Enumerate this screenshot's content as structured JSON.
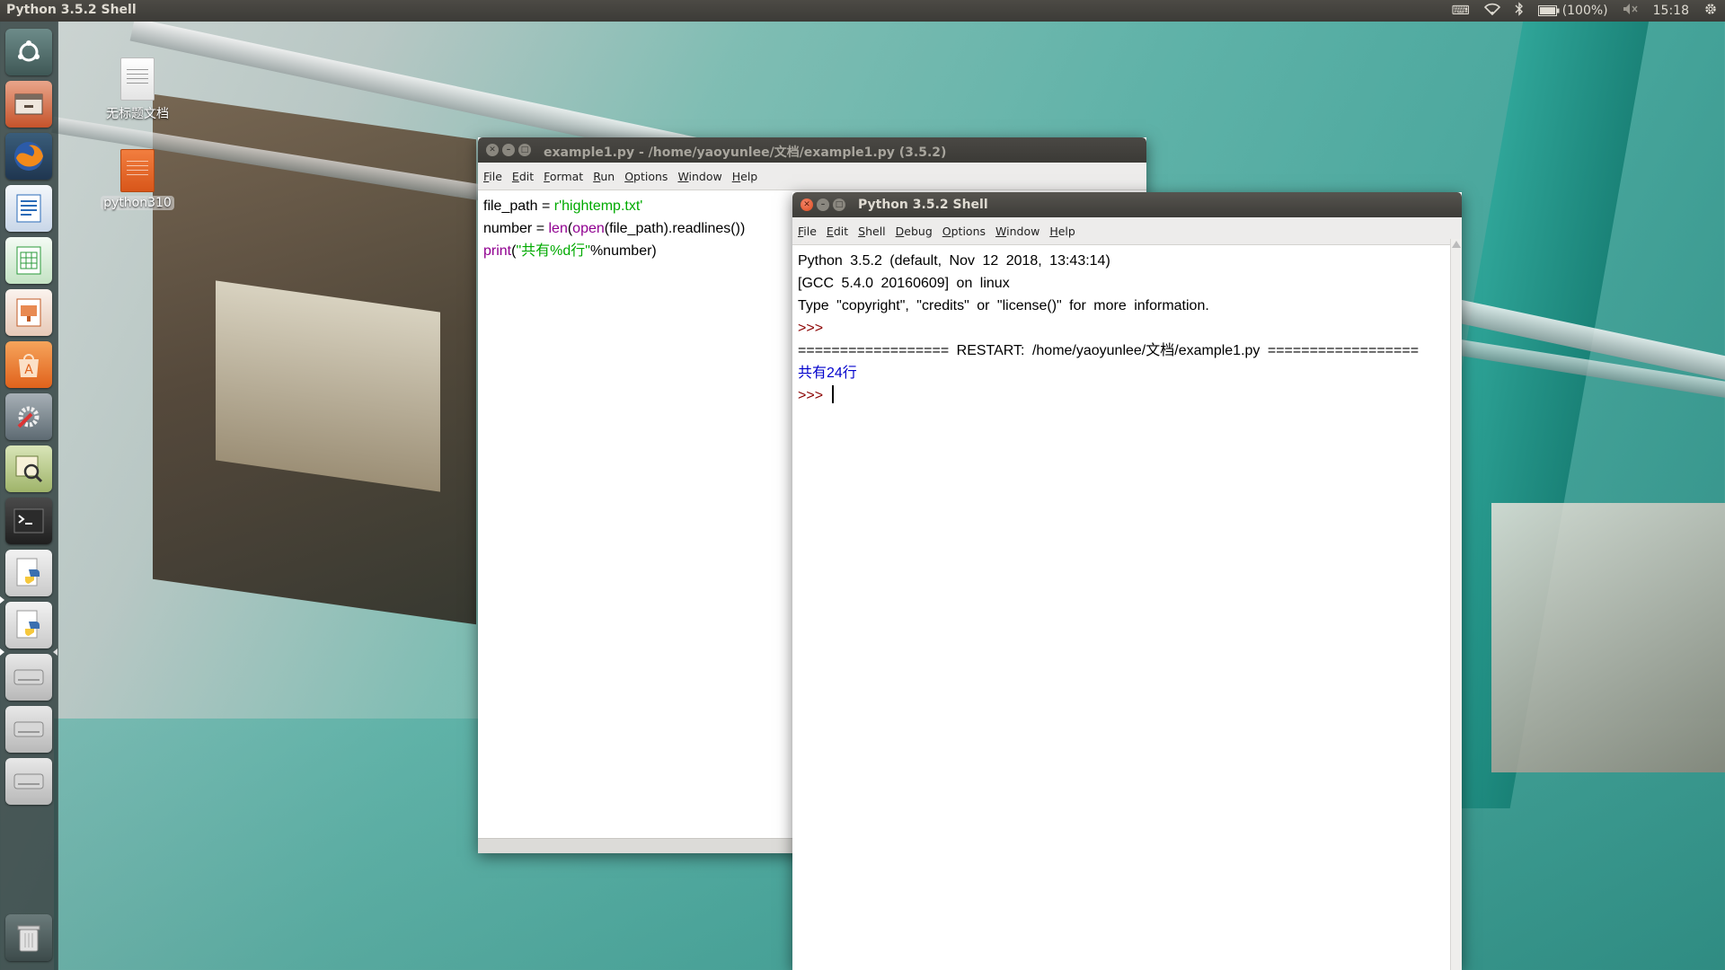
{
  "topbar": {
    "app_title": "Python 3.5.2 Shell",
    "battery": "(100%)",
    "time": "15:18"
  },
  "desktop": {
    "icons": [
      {
        "label": "无标题文档",
        "icon": "document-icon"
      },
      {
        "label": "python310",
        "icon": "python-file-icon"
      }
    ]
  },
  "launcher": {
    "items": [
      "dash-icon",
      "files-icon",
      "firefox-icon",
      "writer-icon",
      "calc-icon",
      "impress-icon",
      "software-center-icon",
      "system-settings-icon",
      "image-viewer-icon",
      "terminal-icon",
      "idle-icon",
      "idle-icon-2",
      "drive-icon",
      "drive-icon-2",
      "drive-icon-3",
      "trash-icon"
    ]
  },
  "editor": {
    "title": "example1.py - /home/yaoyunlee/文档/example1.py (3.5.2)",
    "menu": [
      "File",
      "Edit",
      "Format",
      "Run",
      "Options",
      "Window",
      "Help"
    ],
    "lines": {
      "l1_a": "file_path = ",
      "l1_b": "r'hightemp.txt'",
      "l2_a": "number = ",
      "l2_b": "len",
      "l2_c": "(",
      "l2_d": "open",
      "l2_e": "(file_path).readlines())",
      "l3_a": "print",
      "l3_b": "(",
      "l3_c": "\"共有%d行\"",
      "l3_d": "%number)"
    }
  },
  "shell": {
    "title": "Python 3.5.2 Shell",
    "menu": [
      "File",
      "Edit",
      "Shell",
      "Debug",
      "Options",
      "Window",
      "Help"
    ],
    "banner1": "Python 3.5.2 (default, Nov 12 2018, 13:43:14)",
    "banner2": "[GCC 5.4.0 20160609] on linux",
    "banner3": "Type \"copyright\", \"credits\" or \"license()\" for more information.",
    "prompt1": ">>>",
    "restart": "================== RESTART: /home/yaoyunlee/文档/example1.py ==================",
    "output": "共有24行",
    "prompt2": ">>>"
  },
  "colors": {
    "keyword": "#900090",
    "string": "#00aa00",
    "prompt": "#8b0000",
    "stdout": "#0000cc"
  }
}
